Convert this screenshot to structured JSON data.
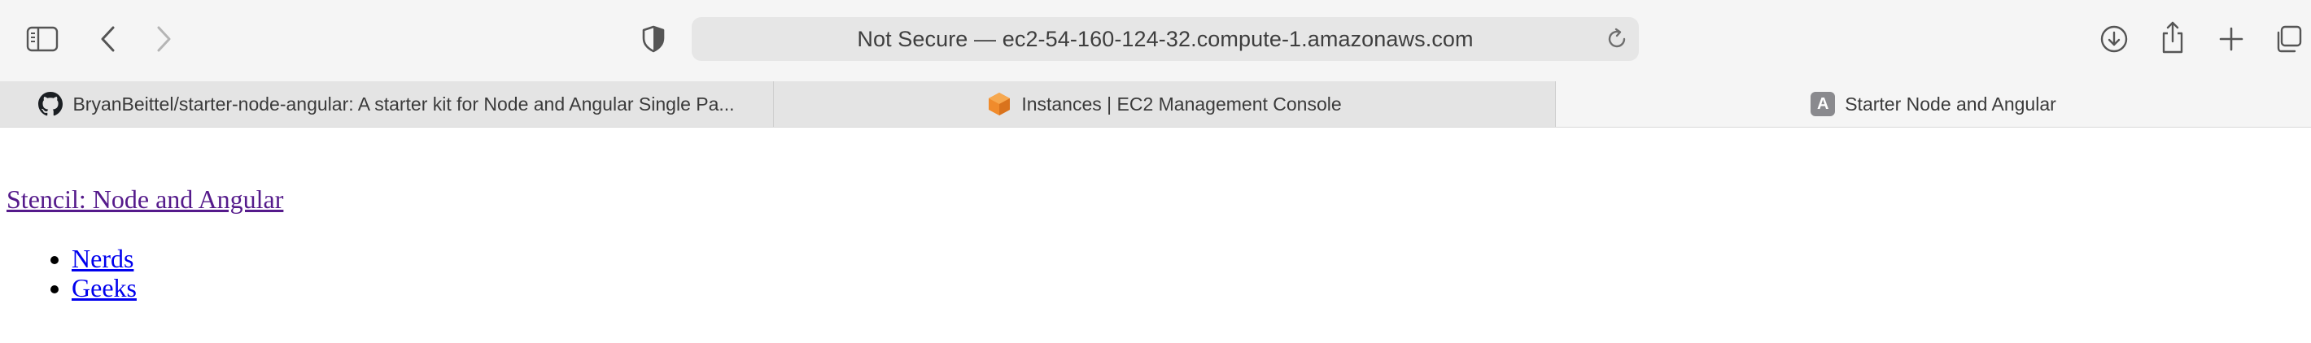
{
  "toolbar": {
    "address": "Not Secure — ec2-54-160-124-32.compute-1.amazonaws.com",
    "icons": {
      "sidebar": "sidebar-icon",
      "back": "chevron-left-icon",
      "forward": "chevron-right-icon",
      "privacy": "privacy-shield-icon",
      "reload": "reload-icon",
      "download": "download-icon",
      "share": "share-icon",
      "new_tab": "plus-icon",
      "tab_overview": "tab-overview-icon"
    }
  },
  "tabs": [
    {
      "label": "BryanBeittel/starter-node-angular: A starter kit for Node and Angular Single Pa...",
      "favicon": "github-icon",
      "active": false
    },
    {
      "label": "Instances | EC2 Management Console",
      "favicon": "aws-ec2-icon",
      "active": false
    },
    {
      "label": "Starter Node and Angular",
      "favicon": "angular-letter-icon",
      "favicon_text": "A",
      "active": true
    }
  ],
  "page": {
    "brand": "Stencil: Node and Angular",
    "nav": [
      {
        "label": "Nerds"
      },
      {
        "label": "Geeks"
      }
    ]
  },
  "colors": {
    "visited_link": "#551a8b",
    "link": "#0000ee",
    "toolbar_bg": "#f5f5f5",
    "address_bg": "#e6e6e6",
    "ec2_orange": "#f08b2c"
  }
}
